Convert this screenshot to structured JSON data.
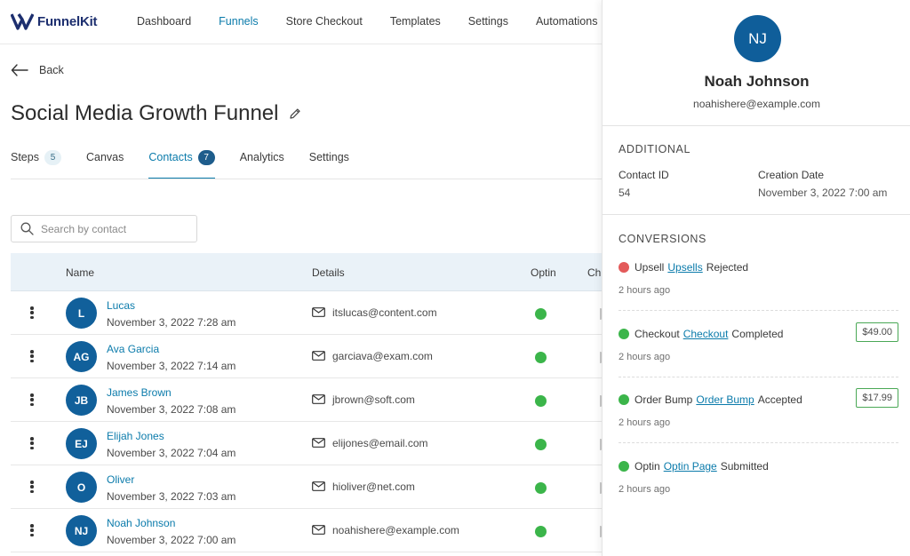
{
  "brand": {
    "name": "FunnelKit"
  },
  "nav": {
    "items": [
      {
        "label": "Dashboard",
        "active": false
      },
      {
        "label": "Funnels",
        "active": true
      },
      {
        "label": "Store Checkout",
        "active": false
      },
      {
        "label": "Templates",
        "active": false
      },
      {
        "label": "Settings",
        "active": false
      },
      {
        "label": "Automations",
        "active": false
      }
    ]
  },
  "back_label": "Back",
  "page_title": "Social Media Growth Funnel",
  "tabs": [
    {
      "label": "Steps",
      "count": "5"
    },
    {
      "label": "Canvas"
    },
    {
      "label": "Contacts",
      "count": "7",
      "active": true
    },
    {
      "label": "Analytics"
    },
    {
      "label": "Settings"
    }
  ],
  "search": {
    "placeholder": "Search by contact",
    "value": ""
  },
  "table": {
    "headers": {
      "name": "Name",
      "details": "Details",
      "optin": "Optin",
      "checkout_partial": "Ch"
    },
    "rows": [
      {
        "initials": "L",
        "name": "Lucas",
        "date": "November 3, 2022 7:28 am",
        "email": "itslucas@content.com"
      },
      {
        "initials": "AG",
        "name": "Ava Garcia",
        "date": "November 3, 2022 7:14 am",
        "email": "garciava@exam.com"
      },
      {
        "initials": "JB",
        "name": "James Brown",
        "date": "November 3, 2022 7:08 am",
        "email": "jbrown@soft.com"
      },
      {
        "initials": "EJ",
        "name": "Elijah Jones",
        "date": "November 3, 2022 7:04 am",
        "email": "elijones@email.com"
      },
      {
        "initials": "O",
        "name": "Oliver",
        "date": "November 3, 2022 7:03 am",
        "email": "hioliver@net.com"
      },
      {
        "initials": "NJ",
        "name": "Noah Johnson",
        "date": "November 3, 2022 7:00 am",
        "email": "noahishere@example.com"
      }
    ]
  },
  "panel": {
    "initials": "NJ",
    "name": "Noah Johnson",
    "email": "noahishere@example.com",
    "additional_heading": "ADDITIONAL",
    "contact_id_label": "Contact ID",
    "contact_id": "54",
    "creation_date_label": "Creation Date",
    "creation_date": "November 3, 2022 7:00 am",
    "conversions_heading": "CONVERSIONS",
    "conversions": [
      {
        "prefix": "Upsell",
        "link": "Upsells",
        "suffix": "Rejected",
        "time": "2 hours ago",
        "status": "rejected",
        "price": ""
      },
      {
        "prefix": "Checkout",
        "link": "Checkout",
        "suffix": "Completed",
        "time": "2 hours ago",
        "status": "success",
        "price": "$49.00"
      },
      {
        "prefix": "Order Bump",
        "link": "Order Bump",
        "suffix": "Accepted",
        "time": "2 hours ago",
        "status": "success",
        "price": "$17.99"
      },
      {
        "prefix": "Optin",
        "link": "Optin Page",
        "suffix": "Submitted",
        "time": "2 hours ago",
        "status": "success",
        "price": ""
      }
    ]
  },
  "colors": {
    "accent": "#0b7bab",
    "avatar": "#11609b",
    "success": "#3bb54a",
    "rejected": "#e35a5a"
  },
  "icons": [
    "funnelkit-logo-icon",
    "back-arrow-icon",
    "edit-pencil-icon",
    "search-icon",
    "kebab-menu-icon",
    "mail-icon",
    "status-dot-icon"
  ]
}
